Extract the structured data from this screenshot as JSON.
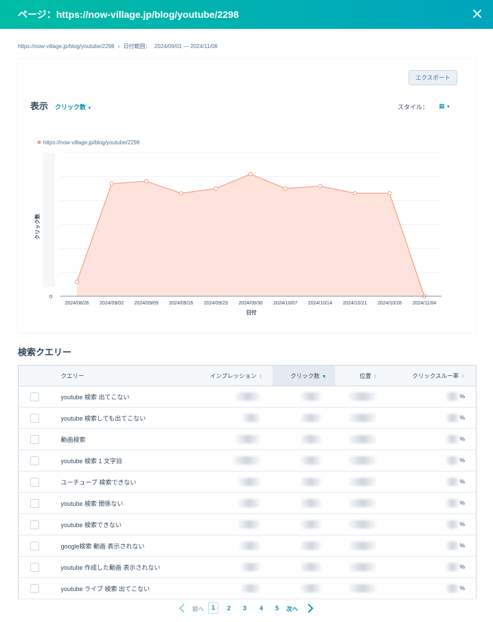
{
  "header": {
    "title": "ページ：https://now-village.jp/blog/youtube/2298"
  },
  "breadcrumb": {
    "page": "https://now-village.jp/blog/youtube/2298",
    "separator": "›",
    "range_label": "日付範囲：",
    "range_value": "2024/09/01 — 2024/11/06"
  },
  "chart_card": {
    "export_label": "エクスポート",
    "display_label": "表示",
    "metric_label": "クリック数",
    "style_label": "スタイル：",
    "style_value": "▦"
  },
  "chart_data": {
    "type": "area",
    "series": [
      {
        "name": "https://now-village.jp/blog/youtube/2298",
        "values": [
          0.6,
          4.7,
          4.8,
          4.3,
          4.5,
          5.1,
          4.5,
          4.6,
          4.3,
          4.3,
          0.0
        ]
      }
    ],
    "x": [
      "2024/08/26",
      "2024/09/02",
      "2024/09/09",
      "2024/09/16",
      "2024/09/23",
      "2024/09/30",
      "2024/10/07",
      "2024/10/14",
      "2024/10/21",
      "2024/10/28",
      "2024/11/04"
    ],
    "xlabel": "日付",
    "ylabel": "クリック数",
    "y_tick_visible": "0",
    "ylim": [
      0,
      6
    ],
    "grid": true,
    "legend": "top-left",
    "colors": {
      "line": "#f59d84",
      "fill": "#fde0d8"
    }
  },
  "queries": {
    "section_title": "検索クエリー",
    "columns": {
      "query": "クエリー",
      "impressions": "インプレッション",
      "clicks": "クリック数",
      "position": "位置",
      "ctr": "クリックスルー率"
    },
    "percent_sign": "%",
    "rows": [
      {
        "query": "youtube 検索 出てこない"
      },
      {
        "query": "youtube 検索しても出てこない"
      },
      {
        "query": "動画検索"
      },
      {
        "query": "youtube 検索 1 文字目"
      },
      {
        "query": "ユーチューブ 検索できない"
      },
      {
        "query": "youtube 検索 関係ない"
      },
      {
        "query": "youtube 検索できない"
      },
      {
        "query": "google検索 動画 表示されない"
      },
      {
        "query": "youtube 作成した動画 表示されない"
      },
      {
        "query": "youtube ライブ 検索 出てこない"
      }
    ]
  },
  "pagination": {
    "prev_label": "前へ",
    "next_label": "次へ",
    "pages": [
      "1",
      "2",
      "3",
      "4",
      "5"
    ],
    "current": "1"
  }
}
